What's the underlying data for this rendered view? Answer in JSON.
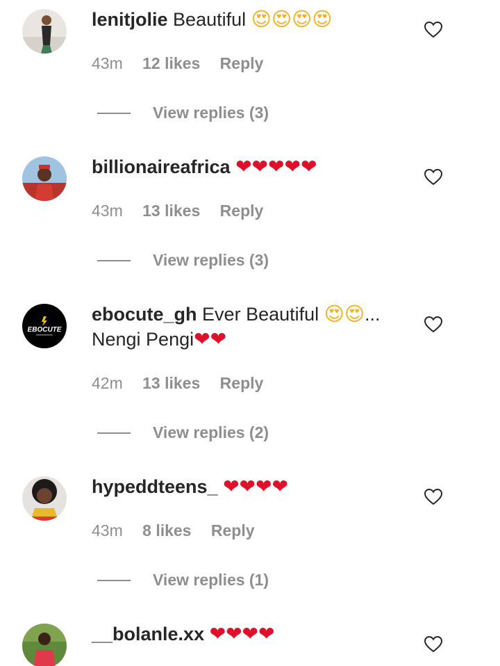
{
  "comments": [
    {
      "username": "lenitjolie",
      "text": "Beautiful",
      "emoji": "😍😍😍😍",
      "time": "43m",
      "likes": "12 likes",
      "reply": "Reply",
      "view_replies": "View replies (3)"
    },
    {
      "username": "billionaireafrica",
      "text": "",
      "emoji": "❤❤❤❤❤",
      "time": "43m",
      "likes": "13 likes",
      "reply": "Reply",
      "view_replies": "View replies (3)"
    },
    {
      "username": "ebocute_gh",
      "text": "Ever Beautiful",
      "emoji": "😍😍",
      "text2": "...",
      "text3": "Nengi Pengi",
      "emoji2": "❤❤",
      "time": "42m",
      "likes": "13 likes",
      "reply": "Reply",
      "view_replies": "View replies (2)",
      "avatar_text": "EBOCUTE"
    },
    {
      "username": "hypeddteens_",
      "text": "",
      "emoji": "❤❤❤❤",
      "time": "43m",
      "likes": "8 likes",
      "reply": "Reply",
      "view_replies": "View replies (1)"
    },
    {
      "username": "__bolanle.xx",
      "text": "",
      "emoji": "❤❤❤❤"
    }
  ],
  "icons": {
    "like": "heart-outline-icon"
  },
  "colors": {
    "text": "#262626",
    "secondary": "#8e8e8e",
    "heart": "#e0102a"
  }
}
